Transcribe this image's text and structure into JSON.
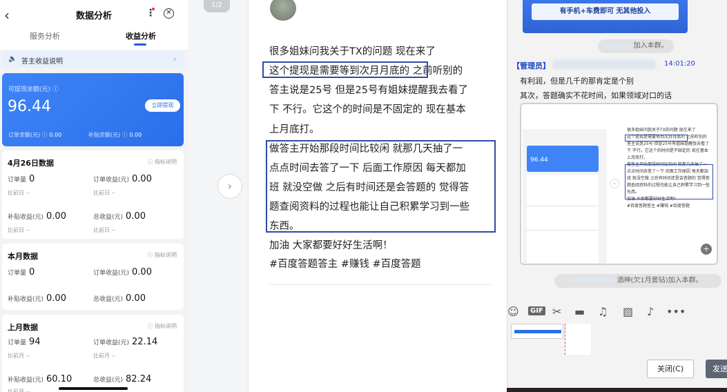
{
  "phone": {
    "title": "数据分析",
    "back_icon": "‹",
    "menu_icon": "⋮",
    "close_icon": "✕",
    "tabs": [
      "服务分析",
      "收益分析"
    ],
    "notice": {
      "icon": "🔈",
      "text": "答主收益说明",
      "arrow": "›"
    },
    "withdraw_card": {
      "label": "可提现余额(元) ⓘ",
      "amount": "96.44",
      "button": "立即提现",
      "order_balance_label": "订单余额(元) ⓘ",
      "order_balance": "0.00",
      "subsidy_balance_label": "补贴余额(元) ⓘ",
      "subsidy_balance": "0.00"
    },
    "sections": [
      {
        "title": "4月26日数据",
        "help": "ⓘ 指标说明",
        "orders_label": "订单量",
        "orders": "0",
        "order_income_label": "订单收益(元)",
        "order_income": "0.00",
        "cmp_label": "比前日",
        "cmp_orders": "--",
        "cmp_income": "--",
        "subsidy_label": "补贴收益(元)",
        "subsidy": "0.00",
        "total_label": "总收益(元)",
        "total": "0.00",
        "cmp_subsidy": "--",
        "cmp_total": "--"
      },
      {
        "title": "本月数据",
        "help": "ⓘ 指标说明",
        "orders_label": "订单量",
        "orders": "0",
        "order_income_label": "订单收益(元)",
        "order_income": "0.00",
        "subsidy_label": "补贴收益(元)",
        "subsidy": "0.00",
        "total_label": "总收益(元)",
        "total": "0.00"
      },
      {
        "title": "上月数据",
        "help": "ⓘ 指标说明",
        "orders_label": "订单量",
        "orders": "94",
        "order_income_label": "订单收益(元)",
        "order_income": "22.14",
        "cmp_label": "比前月",
        "cmp_orders": "--",
        "cmp_income": "--",
        "subsidy_label": "补贴收益(元)",
        "subsidy": "60.10",
        "total_label": "总收益(元)",
        "total": "82.24",
        "cmp_subsidy": "--"
      }
    ]
  },
  "viewer": {
    "pager": "1/2",
    "next_icon": "›"
  },
  "post": {
    "lines": [
      "很多姐妹问我关于TX的问题 现在来了",
      "这个提现是需要等到次月月底的 之前听别的",
      "答主说是25号 但是25号有姐妹提醒我去看了",
      "下  不行。它这个的时间是不固定的 现在基本",
      "上月底打。",
      "做答主开始那段时间比较闲 就那几天抽了一",
      "点点时间去答了一下 后面工作原因 每天都加",
      "班 就没空做 之后有时间还是会答题的 觉得答",
      "题查阅资料的过程也能让自己积累学习到一些",
      "东西。",
      "加油 大家都要好好生活啊！",
      "#百度答题答主 #赚钱 #百度答题"
    ]
  },
  "chat": {
    "banner": "有手机+车费即可 无其他投入",
    "join_notice_1": "加入本群。",
    "admin_tag": "【管理员】",
    "time": "14:01:20",
    "messages": [
      "有利润，但是几千的那肯定是个别",
      "其次，答题确实不花时间，如果领域对口的话"
    ],
    "join_notice_2": "酒神(欠1月套钻)加入本群。",
    "toolbar_icons": [
      "emoji-icon",
      "gif-icon",
      "scissors-icon",
      "folder-icon",
      "music-icon",
      "image-icon",
      "bell-icon",
      "more-icon"
    ],
    "gif_label": "GIF",
    "close_button": "关闭(C)",
    "send_button": "发送"
  }
}
